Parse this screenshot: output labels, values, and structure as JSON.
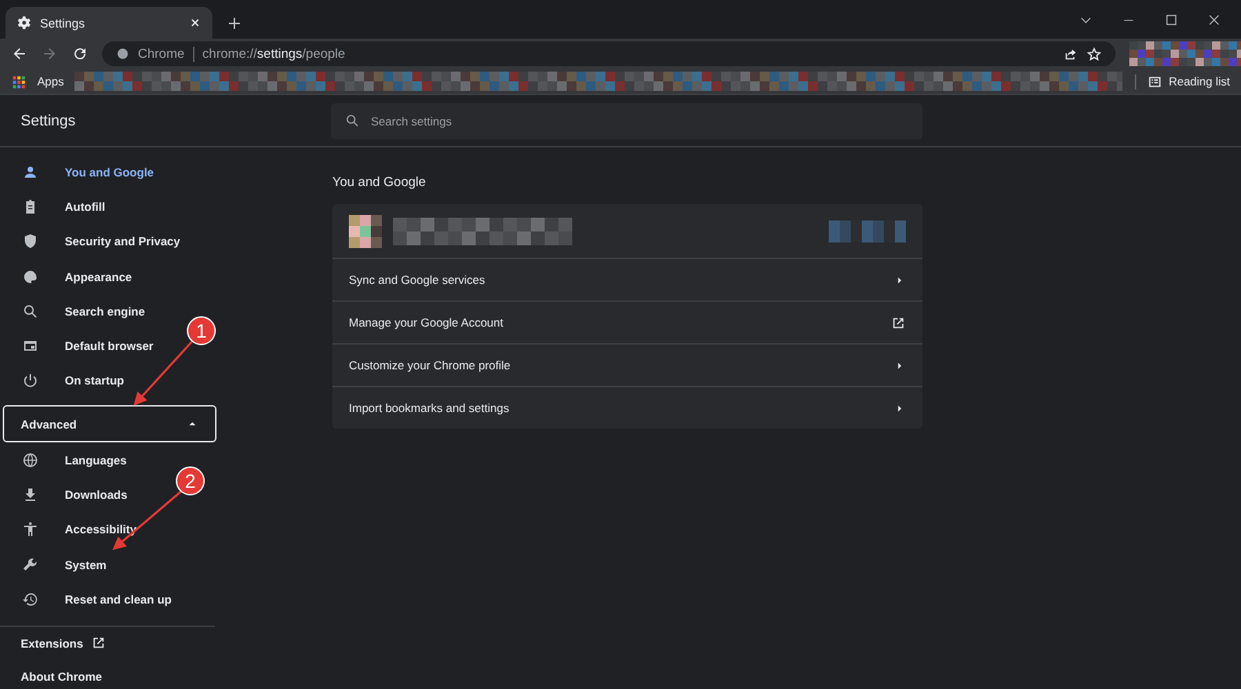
{
  "window": {
    "tabs": [
      {
        "title": "Settings",
        "selected": true
      }
    ],
    "address": {
      "origin_label": "Chrome",
      "url_scheme": "chrome://",
      "url_host": "settings",
      "url_path": "/people"
    }
  },
  "bookmarks_bar": {
    "apps": "Apps",
    "reading_list": "Reading list"
  },
  "settings": {
    "title": "Settings",
    "search_placeholder": "Search settings"
  },
  "sidebar": {
    "items": [
      {
        "label": "You and Google",
        "selected": true
      },
      {
        "label": "Autofill",
        "selected": false
      },
      {
        "label": "Security and Privacy",
        "selected": false
      },
      {
        "label": "Appearance",
        "selected": false
      },
      {
        "label": "Search engine",
        "selected": false
      },
      {
        "label": "Default browser",
        "selected": false
      },
      {
        "label": "On startup",
        "selected": false
      }
    ],
    "advanced": {
      "label": "Advanced",
      "expanded": true,
      "items": [
        {
          "label": "Languages",
          "selected": false
        },
        {
          "label": "Downloads",
          "selected": false
        },
        {
          "label": "Accessibility",
          "selected": false
        },
        {
          "label": "System",
          "selected": false
        },
        {
          "label": "Reset and clean up",
          "selected": false
        }
      ]
    },
    "footer": [
      {
        "label": "Extensions",
        "kind": "external"
      },
      {
        "label": "About Chrome",
        "kind": "plain"
      }
    ]
  },
  "section": {
    "title": "You and Google",
    "rows": [
      {
        "label": "Sync and Google services",
        "kind": "submenu"
      },
      {
        "label": "Manage your Google Account",
        "kind": "external"
      },
      {
        "label": "Customize your Chrome profile",
        "kind": "submenu"
      },
      {
        "label": "Import bookmarks and settings",
        "kind": "submenu"
      }
    ]
  },
  "annotations": [
    {
      "label": "1"
    },
    {
      "label": "2"
    }
  ]
}
